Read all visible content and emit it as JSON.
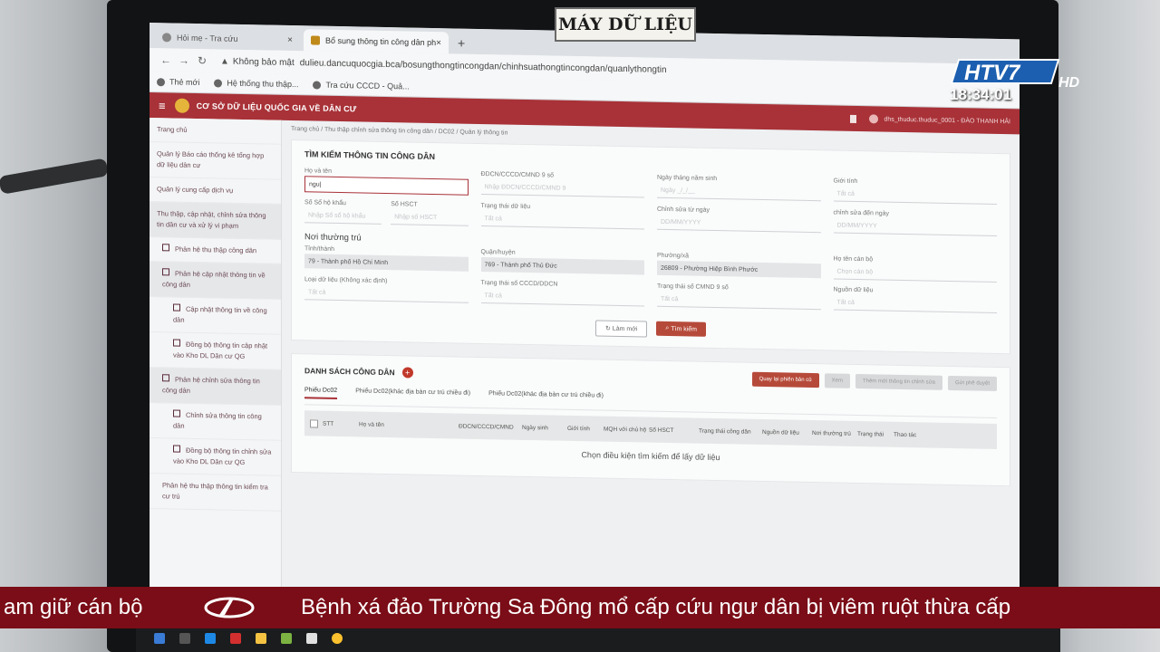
{
  "stamp": "MÁY DỮ LIỆU",
  "broadcast": {
    "channel": "HTV7",
    "suffix": "HD",
    "clock": "18:34:01"
  },
  "ticker": {
    "left": "am giữ cán bộ",
    "main": "Bệnh xá đảo Trường Sa Đông mổ cấp cứu ngư dân bị viêm ruột thừa cấp"
  },
  "browser": {
    "tabs": [
      {
        "label": "Hỏi mẹ - Tra cứu"
      },
      {
        "label": "Bổ sung thông tin công dân phức"
      }
    ],
    "security": "Không bảo mật",
    "url": "dulieu.dancuquocgia.bca/bosungthongtincongdan/chinhsuathongtincongdan/quanlythongtin",
    "bookmarks": [
      "Thẻ mới",
      "Hệ thống thu thập...",
      "Tra cứu CCCD - Quả..."
    ]
  },
  "app": {
    "title": "CƠ SỞ DỮ LIỆU QUỐC GIA VỀ DÂN CƯ",
    "user": "dhs_thuduc.thuduc_0001 - ĐÀO THANH HẢI"
  },
  "sidebar": [
    {
      "label": "Trang chủ"
    },
    {
      "label": "Quản lý Báo cáo thống kê tổng hợp dữ liệu dân cư"
    },
    {
      "label": "Quản lý cung cấp dịch vụ"
    },
    {
      "label": "Thu thập, cập nhật, chỉnh sửa thông tin dân cư và xử lý vi phạm"
    },
    {
      "label": "Phân hệ thu thập công dân"
    },
    {
      "label": "Phân hệ cập nhật thông tin về công dân"
    },
    {
      "label": "Cập nhật thông tin về công dân"
    },
    {
      "label": "Đồng bộ thông tin cập nhật vào Kho DL Dân cư QG"
    },
    {
      "label": "Phân hệ chỉnh sửa thông tin công dân"
    },
    {
      "label": "Chỉnh sửa thông tin công dân"
    },
    {
      "label": "Đồng bộ thông tin chỉnh sửa vào Kho DL Dân cư QG"
    },
    {
      "label": "Phân hệ thu thập thông tin kiểm tra cư trú"
    }
  ],
  "breadcrumb": "Trang chủ / Thu thập chỉnh sửa thông tin công dân / DC02 / Quản lý thông tin",
  "search": {
    "title": "TÌM KIẾM THÔNG TIN CÔNG DÂN",
    "fields": [
      {
        "label": "Họ và tên",
        "value": "ngu|"
      },
      {
        "label": "ĐDCN/CCCD/CMND 9 số",
        "placeholder": "Nhập ĐDCN/CCCD/CMND 9"
      },
      {
        "label": "Ngày tháng năm sinh",
        "placeholder": "Ngày  _/_/__"
      },
      {
        "label": "Giới tính",
        "placeholder": "Tất cả"
      }
    ],
    "fields2": [
      {
        "label": "Số Sổ hộ khẩu",
        "placeholder": "Nhập Số sổ hộ khẩu"
      },
      {
        "label": "Số HSCT",
        "placeholder": "Nhập số HSCT"
      },
      {
        "label": "Trạng thái dữ liệu",
        "placeholder": "Tất cả"
      },
      {
        "label": "Chỉnh sửa từ ngày",
        "placeholder": "DD/MM/YYYY"
      },
      {
        "label": "chỉnh sửa đến ngày",
        "placeholder": "DD/MM/YYYY"
      }
    ],
    "residence_title": "Nơi thường trú",
    "fields3": [
      {
        "label": "Tỉnh/thành",
        "value": "79 - Thành phố Hồ Chí Minh"
      },
      {
        "label": "Quận/huyện",
        "value": "769 - Thành phố Thủ Đức"
      },
      {
        "label": "Phường/xã",
        "value": "26809 - Phường Hiệp Bình Phước"
      },
      {
        "label": "Họ tên cán bộ",
        "placeholder": "Chọn cán bộ"
      }
    ],
    "fields4": [
      {
        "label": "Loại dữ liệu (Không xác định)",
        "placeholder": "Tất cả"
      },
      {
        "label": "Trạng thái số CCCD/DDCN",
        "placeholder": "Tất cả"
      },
      {
        "label": "Trạng thái số CMND 9 số",
        "placeholder": "Tất cả"
      },
      {
        "label": "Nguồn dữ liệu",
        "placeholder": "Tất cả"
      }
    ],
    "reset_label": "Làm mới",
    "search_label": "Tìm kiếm"
  },
  "list": {
    "title": "DANH SÁCH CÔNG DÂN",
    "buttons": [
      "Quay lại phiên bản cũ",
      "Xem",
      "Thêm mới thông tin chỉnh sửa",
      "Gửi phê duyệt"
    ],
    "tabs": [
      "Phiếu Dc02",
      "Phiếu Dc02(khác địa bàn cư trú chiều đi)",
      "Phiếu Dc02(khác địa bàn cư trú chiều đi)"
    ],
    "columns": [
      "STT",
      "Họ và tên",
      "ĐDCN/CCCD/CMND",
      "Ngày sinh",
      "Giới tính",
      "MQH với chủ hộ",
      "Số HSCT",
      "Trạng thái công dân",
      "Nguồn dữ liệu",
      "Nơi thường trú",
      "Trạng thái",
      "Thao tác"
    ],
    "empty": "Chọn điều kiện tìm kiếm để lấy dữ liệu"
  }
}
